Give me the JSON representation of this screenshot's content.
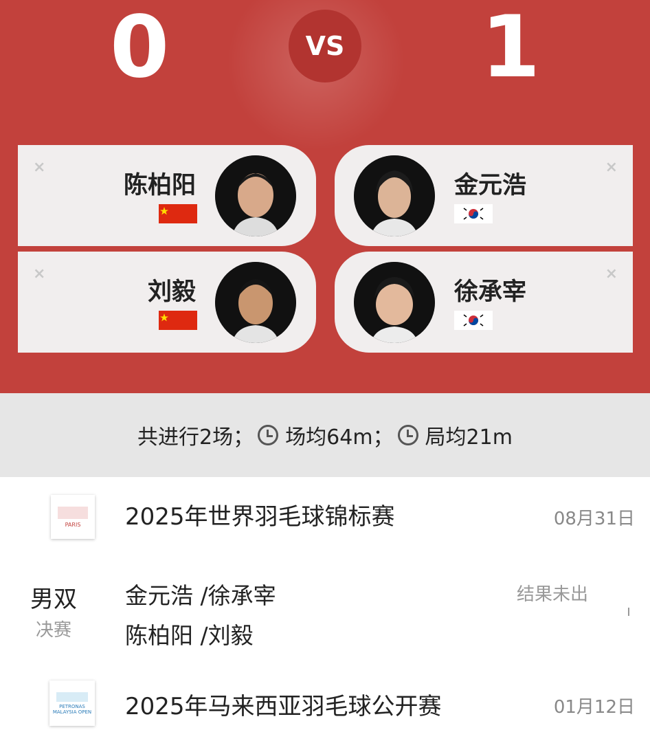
{
  "header": {
    "score_left": "0",
    "vs_label": "VS",
    "score_right": "1"
  },
  "players": {
    "left": [
      {
        "name": "陈柏阳",
        "flag": "cn-flag"
      },
      {
        "name": "刘毅",
        "flag": "cn-flag"
      }
    ],
    "right": [
      {
        "name": "金元浩",
        "flag": "kr-flag"
      },
      {
        "name": "徐承宰",
        "flag": "kr-flag"
      }
    ],
    "close_symbol": "×"
  },
  "stats": {
    "total": "共进行2场；",
    "avg_match": "场均64m；",
    "avg_game": "局均21m"
  },
  "events": [
    {
      "title": "2025年世界羽毛球锦标赛",
      "date": "08月31日",
      "logo_text": "PARIS"
    },
    {
      "title": "2025年马来西亚羽毛球公开赛",
      "date": "01月12日",
      "logo_text": "PETRONAS MALAYSIA OPEN"
    }
  ],
  "match": {
    "type": "男双",
    "stage": "决赛",
    "team1": "金元浩 /徐承宰",
    "team2": "陈柏阳 /刘毅",
    "result": "结果未出"
  },
  "colors": {
    "header_bg": "#c2413c",
    "card_bg": "#f1eeee"
  }
}
